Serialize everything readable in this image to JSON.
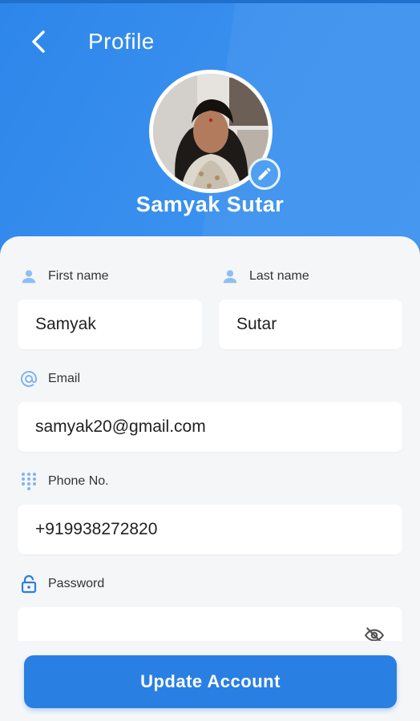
{
  "header": {
    "title": "Profile",
    "user_name": "Samyak Sutar"
  },
  "form": {
    "first_name": {
      "label": "First name",
      "value": "Samyak"
    },
    "last_name": {
      "label": "Last name",
      "value": "Sutar"
    },
    "email": {
      "label": "Email",
      "value": "samyak20@gmail.com"
    },
    "phone": {
      "label": "Phone No.",
      "value": "+919938272820"
    },
    "password": {
      "label": "Password",
      "value": ""
    }
  },
  "actions": {
    "update_label": "Update Account"
  },
  "icons": {
    "back": "back-arrow-icon",
    "edit": "pencil-icon",
    "person": "person-icon",
    "email": "at-icon",
    "phone": "dialpad-icon",
    "password": "lock-icon",
    "visibility": "eye-off-icon"
  },
  "colors": {
    "header_blue": "#3a90ee",
    "button_blue": "#2a7fe3",
    "icon_blue": "#4a9af0"
  }
}
